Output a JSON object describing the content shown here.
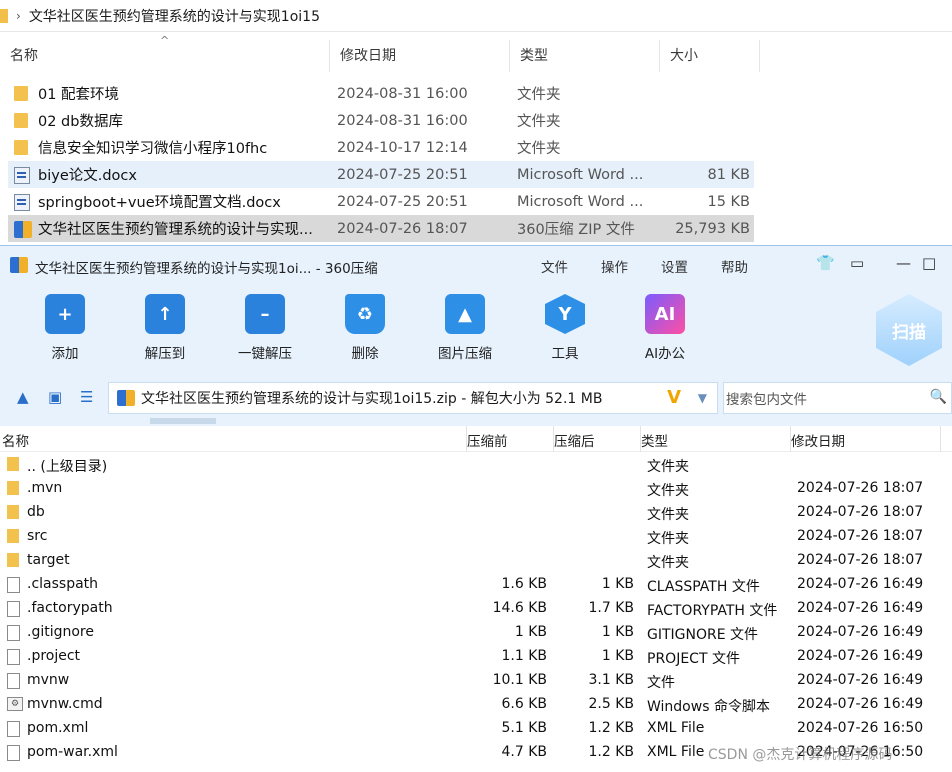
{
  "explorer": {
    "breadcrumb": "文华社区医生预约管理系统的设计与实现1oi15",
    "columns": {
      "name": "名称",
      "date": "修改日期",
      "type": "类型",
      "size": "大小"
    },
    "rows": [
      {
        "name": "01 配套环境",
        "date": "2024-08-31 16:00",
        "type": "文件夹",
        "size": ""
      },
      {
        "name": "02 db数据库",
        "date": "2024-08-31 16:00",
        "type": "文件夹",
        "size": ""
      },
      {
        "name": "信息安全知识学习微信小程序10fhc",
        "date": "2024-10-17 12:14",
        "type": "文件夹",
        "size": ""
      },
      {
        "name": "biye论文.docx",
        "date": "2024-07-25 20:51",
        "type": "Microsoft Word ...",
        "size": "81 KB"
      },
      {
        "name": "springboot+vue环境配置文档.docx",
        "date": "2024-07-25 20:51",
        "type": "Microsoft Word ...",
        "size": "15 KB"
      },
      {
        "name": "文华社区医生预约管理系统的设计与实现...",
        "date": "2024-07-26 18:07",
        "type": "360压缩 ZIP 文件",
        "size": "25,793 KB"
      }
    ]
  },
  "zip": {
    "title": "文华社区医生预约管理系统的设计与实现1oi... - 360压缩",
    "menu": {
      "file": "文件",
      "ops": "操作",
      "settings": "设置",
      "help": "帮助"
    },
    "tools": {
      "add": "添加",
      "extract_to": "解压到",
      "one_click": "一键解压",
      "delete": "删除",
      "image_compress": "图片压缩",
      "tools": "工具",
      "ai": "AI办公",
      "scan": "扫描"
    },
    "address": "文华社区医生预约管理系统的设计与实现1oi15.zip - 解包大小为 52.1 MB",
    "search_placeholder": "搜索包内文件",
    "columns": {
      "name": "名称",
      "compressed_before": "压缩前",
      "compressed_after": "压缩后",
      "type": "类型",
      "date": "修改日期"
    },
    "rows": [
      {
        "icon": "folder",
        "name": ".. (上级目录)",
        "before": "",
        "after": "",
        "type": "文件夹",
        "date": ""
      },
      {
        "icon": "folder",
        "name": ".mvn",
        "before": "",
        "after": "",
        "type": "文件夹",
        "date": "2024-07-26 18:07"
      },
      {
        "icon": "folder",
        "name": "db",
        "before": "",
        "after": "",
        "type": "文件夹",
        "date": "2024-07-26 18:07"
      },
      {
        "icon": "folder",
        "name": "src",
        "before": "",
        "after": "",
        "type": "文件夹",
        "date": "2024-07-26 18:07"
      },
      {
        "icon": "folder",
        "name": "target",
        "before": "",
        "after": "",
        "type": "文件夹",
        "date": "2024-07-26 18:07"
      },
      {
        "icon": "file",
        "name": ".classpath",
        "before": "1.6 KB",
        "after": "1 KB",
        "type": "CLASSPATH 文件",
        "date": "2024-07-26 16:49"
      },
      {
        "icon": "file",
        "name": ".factorypath",
        "before": "14.6 KB",
        "after": "1.7 KB",
        "type": "FACTORYPATH 文件",
        "date": "2024-07-26 16:49"
      },
      {
        "icon": "file",
        "name": ".gitignore",
        "before": "1 KB",
        "after": "1 KB",
        "type": "GITIGNORE 文件",
        "date": "2024-07-26 16:49"
      },
      {
        "icon": "file",
        "name": ".project",
        "before": "1.1 KB",
        "after": "1 KB",
        "type": "PROJECT 文件",
        "date": "2024-07-26 16:49"
      },
      {
        "icon": "file",
        "name": "mvnw",
        "before": "10.1 KB",
        "after": "3.1 KB",
        "type": "文件",
        "date": "2024-07-26 16:49"
      },
      {
        "icon": "cmd",
        "name": "mvnw.cmd",
        "before": "6.6 KB",
        "after": "2.5 KB",
        "type": "Windows 命令脚本",
        "date": "2024-07-26 16:49"
      },
      {
        "icon": "file",
        "name": "pom.xml",
        "before": "5.1 KB",
        "after": "1.2 KB",
        "type": "XML File",
        "date": "2024-07-26 16:50"
      },
      {
        "icon": "file",
        "name": "pom-war.xml",
        "before": "4.7 KB",
        "after": "1.2 KB",
        "type": "XML File",
        "date": "2024-07-26 16:50"
      }
    ],
    "watermark": "CSDN @杰克计算机程序源码"
  },
  "colors": {
    "toolbar_bg": "#e7f2fd",
    "selection": "#e6f0fb",
    "accent": "#2a6fc7"
  }
}
